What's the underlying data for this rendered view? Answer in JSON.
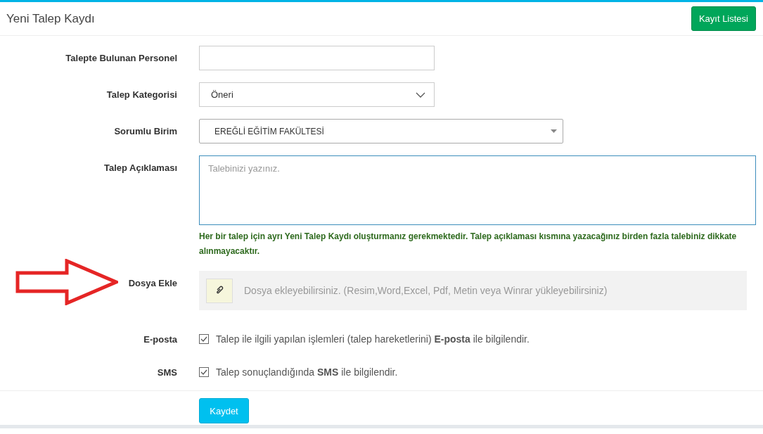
{
  "header": {
    "title": "Yeni Talep Kaydı",
    "button": "Kayıt Listesi"
  },
  "rows": [
    {
      "kind": "text",
      "label": "Talepte Bulunan Personel"
    },
    {
      "kind": "select",
      "label": "Talep Kategorisi",
      "value": "Öneri"
    },
    {
      "kind": "dropdown",
      "label": "Sorumlu Birim",
      "value": "EREĞLİ EĞİTİM FAKÜLTESİ"
    },
    {
      "kind": "textarea",
      "label": "Talep Açıklaması",
      "placeholder": "Talebinizi yazınız.",
      "help": "Her bir talep için ayrı Yeni Talep Kaydı oluşturmanız gerekmektedir. Talep açıklaması kısmına yazacağınız birden fazla talebiniz dikkate alınmayacaktır."
    },
    {
      "kind": "file",
      "label": "Dosya Ekle",
      "text": "Dosya ekleyebilirsiniz. (Resim,Word,Excel, Pdf, Metin veya Winrar yükleyebilirsiniz)"
    },
    {
      "kind": "checkbox",
      "label": "E-posta",
      "checked": true,
      "text": "Talep ile ilgili yapılan işlemleri (talep hareketlerini) **E-posta** ile bilgilendir."
    },
    {
      "kind": "checkbox",
      "label": "SMS",
      "checked": true,
      "text": "Talep sonuçlandığında **SMS** ile bilgilendir."
    }
  ],
  "submit": "Kaydet"
}
